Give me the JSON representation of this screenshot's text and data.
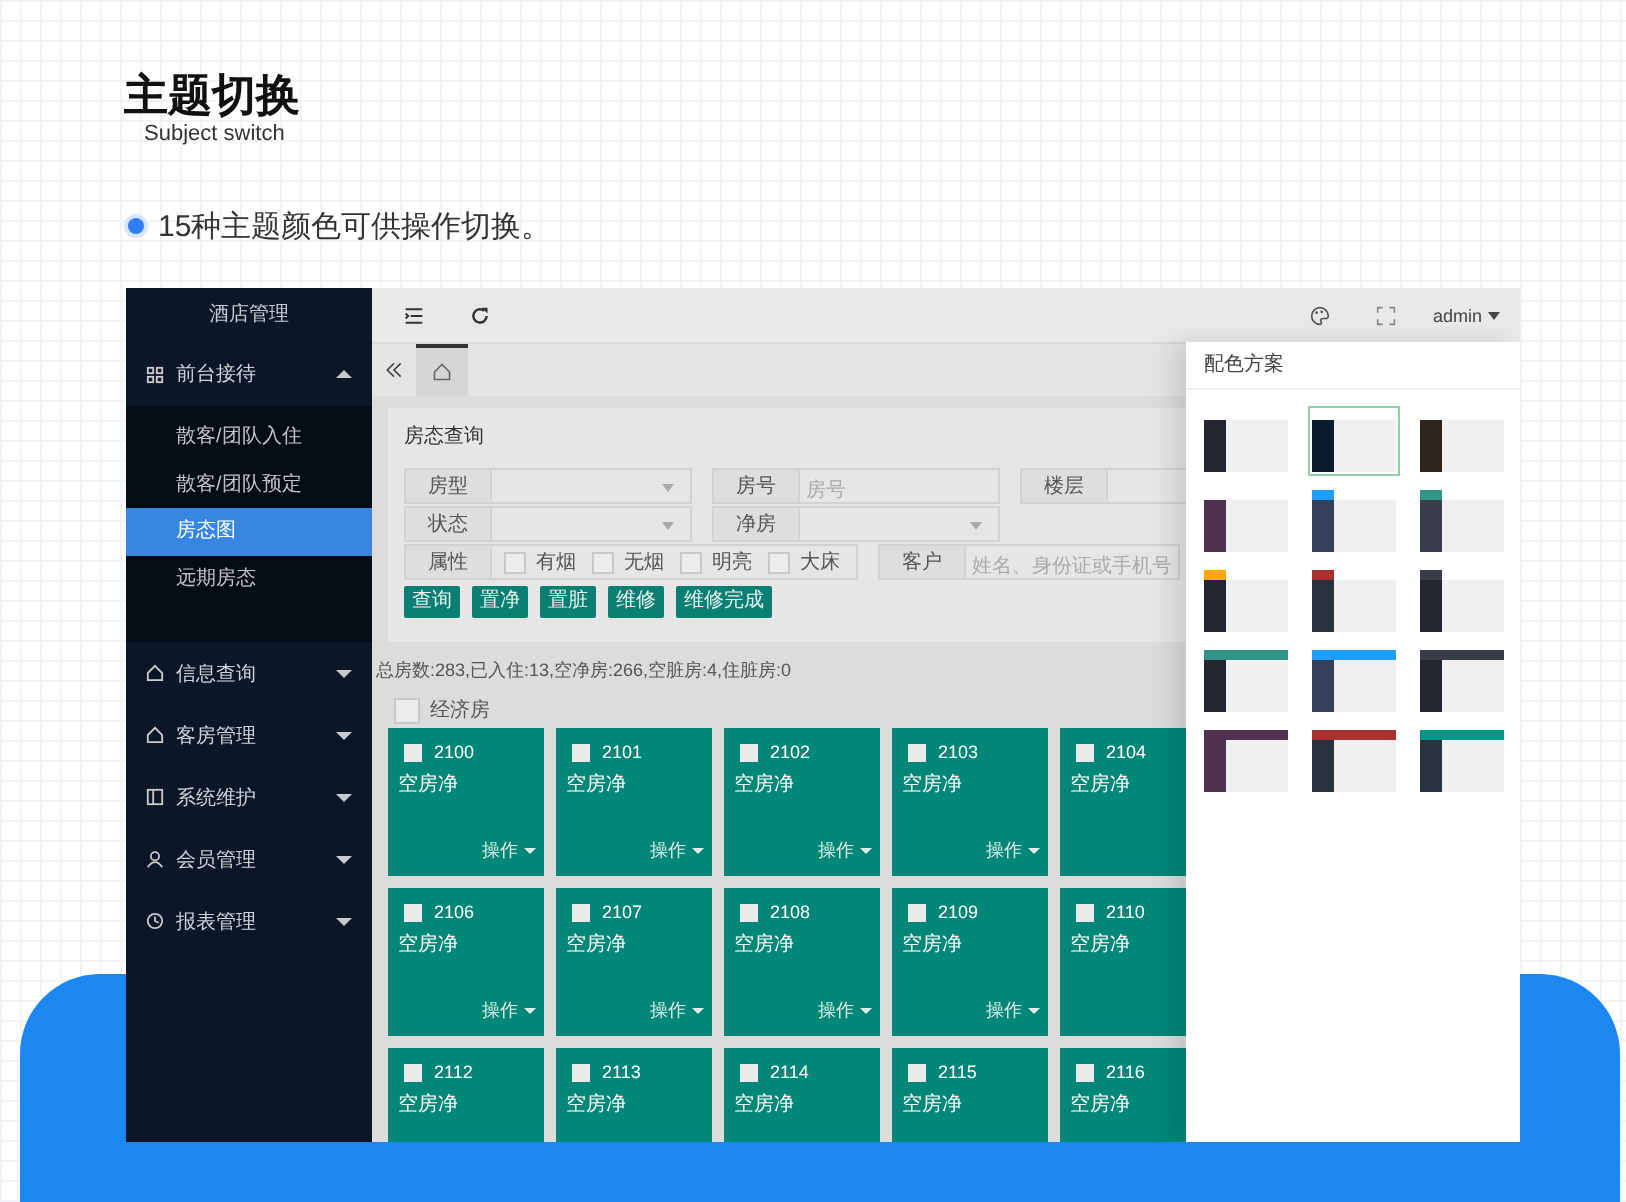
{
  "heading": {
    "title": "主题切换",
    "subtitle": "Subject switch"
  },
  "bullet": "15种主题颜色可供操作切换。",
  "sidebar": {
    "title": "酒店管理",
    "groups": [
      {
        "label": "前台接待",
        "expanded": true,
        "children": [
          {
            "label": "散客/团队入住",
            "selected": false
          },
          {
            "label": "散客/团队预定",
            "selected": false
          },
          {
            "label": "房态图",
            "selected": true
          },
          {
            "label": "远期房态",
            "selected": false
          }
        ]
      },
      {
        "label": "信息查询",
        "expanded": false
      },
      {
        "label": "客房管理",
        "expanded": false
      },
      {
        "label": "系统维护",
        "expanded": false
      },
      {
        "label": "会员管理",
        "expanded": false
      },
      {
        "label": "报表管理",
        "expanded": false
      }
    ]
  },
  "header": {
    "user": "admin"
  },
  "query": {
    "title": "房态查询",
    "rows": [
      {
        "fields": [
          {
            "label": "房型",
            "kind": "select"
          },
          {
            "label": "房号",
            "kind": "input",
            "placeholder": "房号"
          },
          {
            "label": "楼层",
            "kind": "input"
          }
        ]
      },
      {
        "fields": [
          {
            "label": "状态",
            "kind": "select"
          },
          {
            "label": "净房",
            "kind": "select"
          }
        ]
      },
      {
        "fields": [
          {
            "label": "属性",
            "kind": "checks",
            "options": [
              {
                "label": "有烟",
                "checked": false
              },
              {
                "label": "无烟",
                "checked": false
              },
              {
                "label": "明亮",
                "checked": false
              },
              {
                "label": "大床",
                "checked": false
              }
            ]
          },
          {
            "label": "客户",
            "kind": "input",
            "placeholder": "姓名、身份证或手机号"
          }
        ]
      }
    ],
    "buttons": [
      "查询",
      "置净",
      "置脏",
      "维修",
      "维修完成"
    ]
  },
  "summary": "总房数:283,已入住:13,空净房:266,空脏房:4,住脏房:0",
  "filter": {
    "label": "经济房",
    "checked": false
  },
  "rooms": [
    {
      "number": "2100",
      "status": "空房净",
      "checked": false,
      "action": "操作"
    },
    {
      "number": "2101",
      "status": "空房净",
      "checked": false,
      "action": "操作"
    },
    {
      "number": "2102",
      "status": "空房净",
      "checked": false,
      "action": "操作"
    },
    {
      "number": "2103",
      "status": "空房净",
      "checked": false,
      "action": "操作"
    },
    {
      "number": "2104",
      "status": "空房净",
      "checked": false
    },
    {
      "number": "2106",
      "status": "空房净",
      "checked": false,
      "action": "操作"
    },
    {
      "number": "2107",
      "status": "空房净",
      "checked": false,
      "action": "操作"
    },
    {
      "number": "2108",
      "status": "空房净",
      "checked": false,
      "action": "操作"
    },
    {
      "number": "2109",
      "status": "空房净",
      "checked": false,
      "action": "操作"
    },
    {
      "number": "2110",
      "status": "空房净",
      "checked": false
    },
    {
      "number": "2112",
      "status": "空房净",
      "checked": false
    },
    {
      "number": "2113",
      "status": "空房净",
      "checked": false
    },
    {
      "number": "2114",
      "status": "空房净",
      "checked": false
    },
    {
      "number": "2115",
      "status": "空房净",
      "checked": false
    },
    {
      "number": "2116",
      "status": "空房净",
      "checked": false
    }
  ],
  "theme_panel": {
    "title": "配色方案",
    "schemes": [
      {
        "kind": "plain",
        "color": "#23262e",
        "selected": false
      },
      {
        "kind": "plain",
        "color": "#0c1a2e",
        "selected": true
      },
      {
        "kind": "plain",
        "color": "#2f241d",
        "selected": false
      },
      {
        "kind": "plain",
        "color": "#50314f",
        "selected": false
      },
      {
        "kind": "logo",
        "color": "#344058",
        "accent": {
          "color": "#1e9fff"
        },
        "selected": false
      },
      {
        "kind": "logo",
        "color": "#393d49",
        "accent": {
          "color": "#2f9688"
        },
        "selected": false
      },
      {
        "kind": "logo",
        "color": "#23262e",
        "accent": {
          "color": "#ffa500"
        },
        "selected": false
      },
      {
        "kind": "logo",
        "color": "#28333e",
        "accent": {
          "color": "#aa3130"
        },
        "selected": false
      },
      {
        "kind": "logo",
        "color": "#23262e",
        "accent": {
          "color": "#393d49"
        },
        "selected": false
      },
      {
        "kind": "header",
        "color": "#23262e",
        "accent": {
          "color": "#2f9688"
        },
        "selected": false
      },
      {
        "kind": "header",
        "color": "#344058",
        "accent": {
          "color": "#1e9fff"
        },
        "selected": false
      },
      {
        "kind": "header",
        "color": "#23262e",
        "accent": {
          "color": "#393d49"
        },
        "selected": false
      },
      {
        "kind": "header",
        "color": "#50314f",
        "accent": {
          "color": "#50314f"
        },
        "selected": false
      },
      {
        "kind": "header",
        "color": "#28333e",
        "accent": {
          "color": "#aa3130"
        },
        "selected": false
      },
      {
        "kind": "header",
        "color": "#28333e",
        "accent": {
          "color": "#009688"
        },
        "selected": false
      }
    ]
  }
}
